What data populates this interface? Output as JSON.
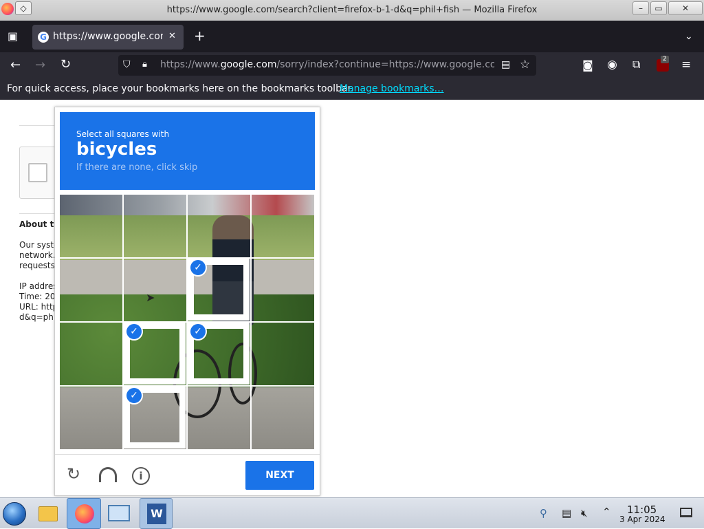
{
  "window": {
    "title": "https://www.google.com/search?client=firefox-b-1-d&q=phil+fish — Mozilla Firefox",
    "minimize_glyph": "–",
    "restore_glyph": "▭",
    "close_glyph": "✕"
  },
  "tab": {
    "label": "https://www.google.com/",
    "close_glyph": "✕",
    "new_tab_glyph": "+"
  },
  "address": {
    "url_prefix": "https://www.",
    "url_domain": "google.com",
    "url_rest": "/sorry/index?continue=https://www.google.co"
  },
  "extensions": {
    "ublock_badge": "2"
  },
  "bookmarks_bar": {
    "message": "For quick access, place your bookmarks here on the bookmarks toolbar.",
    "link": "Manage bookmarks…"
  },
  "background_page": {
    "heading": "About th",
    "line1": "Our syste",
    "line2": "network.",
    "line3": "requests",
    "ip": "IP addres",
    "time": "Time: 20",
    "url": "URL: http",
    "url2": "d&q=phil"
  },
  "captcha": {
    "instruction": "Select all squares with",
    "target": "bicycles",
    "hint": "If there are none, click skip",
    "next_label": "NEXT",
    "selected_tiles": [
      6,
      9,
      10,
      13
    ]
  },
  "taskbar": {
    "time": "11:05",
    "date": "3 Apr 2024"
  },
  "colors": {
    "accent": "#1a73e8",
    "chrome_dark": "#2b2a33",
    "tab_active": "#42414d"
  }
}
